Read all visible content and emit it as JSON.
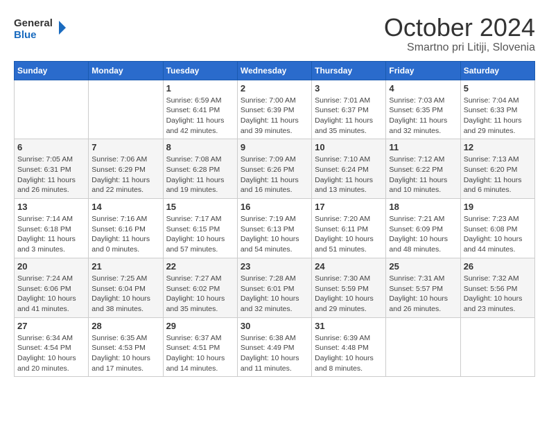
{
  "header": {
    "logo_general": "General",
    "logo_blue": "Blue",
    "month_title": "October 2024",
    "subtitle": "Smartno pri Litiji, Slovenia"
  },
  "days_of_week": [
    "Sunday",
    "Monday",
    "Tuesday",
    "Wednesday",
    "Thursday",
    "Friday",
    "Saturday"
  ],
  "weeks": [
    [
      {
        "day": "",
        "info": ""
      },
      {
        "day": "",
        "info": ""
      },
      {
        "day": "1",
        "info": "Sunrise: 6:59 AM\nSunset: 6:41 PM\nDaylight: 11 hours and 42 minutes."
      },
      {
        "day": "2",
        "info": "Sunrise: 7:00 AM\nSunset: 6:39 PM\nDaylight: 11 hours and 39 minutes."
      },
      {
        "day": "3",
        "info": "Sunrise: 7:01 AM\nSunset: 6:37 PM\nDaylight: 11 hours and 35 minutes."
      },
      {
        "day": "4",
        "info": "Sunrise: 7:03 AM\nSunset: 6:35 PM\nDaylight: 11 hours and 32 minutes."
      },
      {
        "day": "5",
        "info": "Sunrise: 7:04 AM\nSunset: 6:33 PM\nDaylight: 11 hours and 29 minutes."
      }
    ],
    [
      {
        "day": "6",
        "info": "Sunrise: 7:05 AM\nSunset: 6:31 PM\nDaylight: 11 hours and 26 minutes."
      },
      {
        "day": "7",
        "info": "Sunrise: 7:06 AM\nSunset: 6:29 PM\nDaylight: 11 hours and 22 minutes."
      },
      {
        "day": "8",
        "info": "Sunrise: 7:08 AM\nSunset: 6:28 PM\nDaylight: 11 hours and 19 minutes."
      },
      {
        "day": "9",
        "info": "Sunrise: 7:09 AM\nSunset: 6:26 PM\nDaylight: 11 hours and 16 minutes."
      },
      {
        "day": "10",
        "info": "Sunrise: 7:10 AM\nSunset: 6:24 PM\nDaylight: 11 hours and 13 minutes."
      },
      {
        "day": "11",
        "info": "Sunrise: 7:12 AM\nSunset: 6:22 PM\nDaylight: 11 hours and 10 minutes."
      },
      {
        "day": "12",
        "info": "Sunrise: 7:13 AM\nSunset: 6:20 PM\nDaylight: 11 hours and 6 minutes."
      }
    ],
    [
      {
        "day": "13",
        "info": "Sunrise: 7:14 AM\nSunset: 6:18 PM\nDaylight: 11 hours and 3 minutes."
      },
      {
        "day": "14",
        "info": "Sunrise: 7:16 AM\nSunset: 6:16 PM\nDaylight: 11 hours and 0 minutes."
      },
      {
        "day": "15",
        "info": "Sunrise: 7:17 AM\nSunset: 6:15 PM\nDaylight: 10 hours and 57 minutes."
      },
      {
        "day": "16",
        "info": "Sunrise: 7:19 AM\nSunset: 6:13 PM\nDaylight: 10 hours and 54 minutes."
      },
      {
        "day": "17",
        "info": "Sunrise: 7:20 AM\nSunset: 6:11 PM\nDaylight: 10 hours and 51 minutes."
      },
      {
        "day": "18",
        "info": "Sunrise: 7:21 AM\nSunset: 6:09 PM\nDaylight: 10 hours and 48 minutes."
      },
      {
        "day": "19",
        "info": "Sunrise: 7:23 AM\nSunset: 6:08 PM\nDaylight: 10 hours and 44 minutes."
      }
    ],
    [
      {
        "day": "20",
        "info": "Sunrise: 7:24 AM\nSunset: 6:06 PM\nDaylight: 10 hours and 41 minutes."
      },
      {
        "day": "21",
        "info": "Sunrise: 7:25 AM\nSunset: 6:04 PM\nDaylight: 10 hours and 38 minutes."
      },
      {
        "day": "22",
        "info": "Sunrise: 7:27 AM\nSunset: 6:02 PM\nDaylight: 10 hours and 35 minutes."
      },
      {
        "day": "23",
        "info": "Sunrise: 7:28 AM\nSunset: 6:01 PM\nDaylight: 10 hours and 32 minutes."
      },
      {
        "day": "24",
        "info": "Sunrise: 7:30 AM\nSunset: 5:59 PM\nDaylight: 10 hours and 29 minutes."
      },
      {
        "day": "25",
        "info": "Sunrise: 7:31 AM\nSunset: 5:57 PM\nDaylight: 10 hours and 26 minutes."
      },
      {
        "day": "26",
        "info": "Sunrise: 7:32 AM\nSunset: 5:56 PM\nDaylight: 10 hours and 23 minutes."
      }
    ],
    [
      {
        "day": "27",
        "info": "Sunrise: 6:34 AM\nSunset: 4:54 PM\nDaylight: 10 hours and 20 minutes."
      },
      {
        "day": "28",
        "info": "Sunrise: 6:35 AM\nSunset: 4:53 PM\nDaylight: 10 hours and 17 minutes."
      },
      {
        "day": "29",
        "info": "Sunrise: 6:37 AM\nSunset: 4:51 PM\nDaylight: 10 hours and 14 minutes."
      },
      {
        "day": "30",
        "info": "Sunrise: 6:38 AM\nSunset: 4:49 PM\nDaylight: 10 hours and 11 minutes."
      },
      {
        "day": "31",
        "info": "Sunrise: 6:39 AM\nSunset: 4:48 PM\nDaylight: 10 hours and 8 minutes."
      },
      {
        "day": "",
        "info": ""
      },
      {
        "day": "",
        "info": ""
      }
    ]
  ]
}
